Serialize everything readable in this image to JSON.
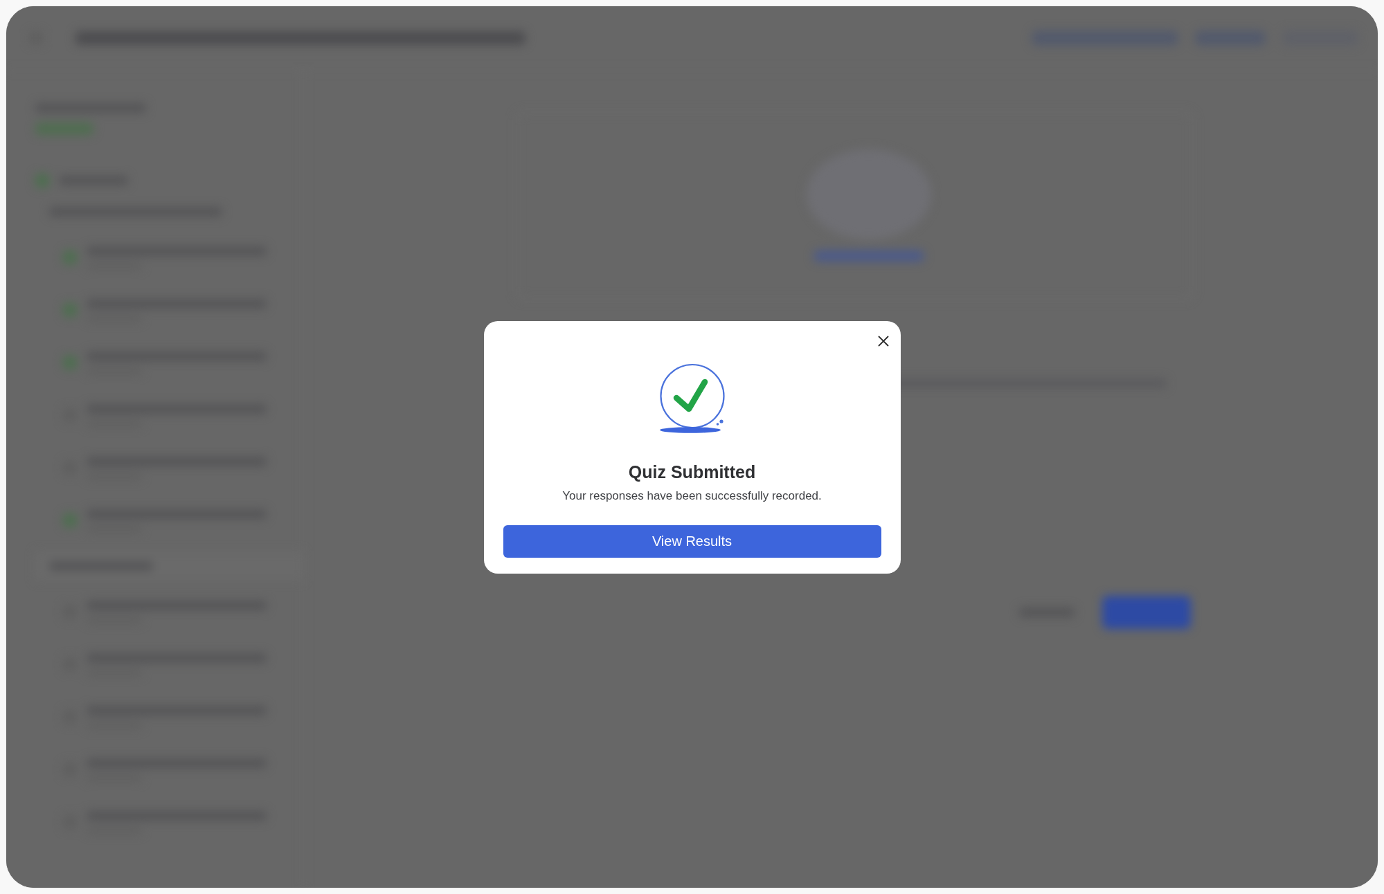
{
  "dialog": {
    "title": "Quiz Submitted",
    "message": "Your responses have been successfully recorded.",
    "primary_button": "View Results"
  }
}
